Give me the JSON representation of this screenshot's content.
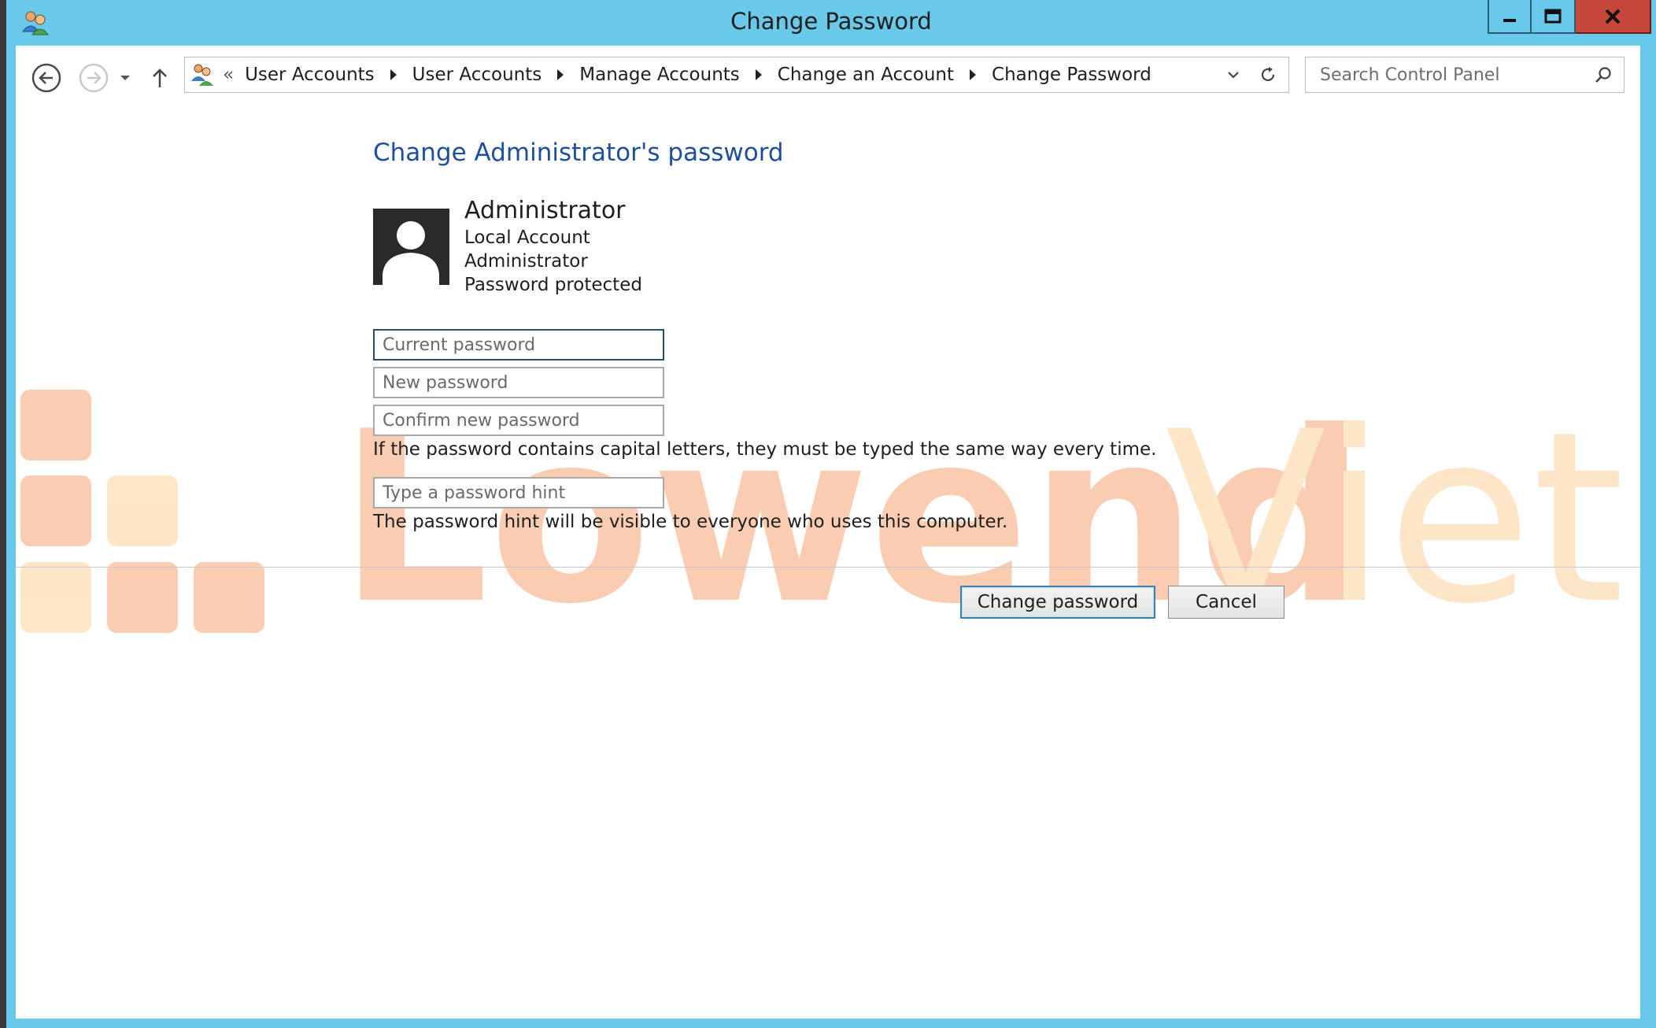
{
  "window": {
    "title": "Change Password"
  },
  "navigation": {
    "breadcrumb_prefix": "«",
    "breadcrumbs": [
      "User Accounts",
      "User Accounts",
      "Manage Accounts",
      "Change an Account",
      "Change Password"
    ]
  },
  "search": {
    "placeholder": "Search Control Panel",
    "value": ""
  },
  "page": {
    "heading": "Change Administrator's password",
    "account": {
      "name": "Administrator",
      "type": "Local Account",
      "role": "Administrator",
      "status": "Password protected"
    },
    "fields": {
      "current_placeholder": "Current password",
      "new_placeholder": "New password",
      "confirm_placeholder": "Confirm new password",
      "hint_placeholder": "Type a password hint"
    },
    "capital_note": "If the password contains capital letters, they must be typed the same way every time.",
    "hint_note": "The password hint will be visible to everyone who uses this computer.",
    "buttons": {
      "change": "Change password",
      "cancel": "Cancel"
    }
  },
  "watermark": {
    "text_main": "Lowend",
    "text_accent": "Viet"
  },
  "colors": {
    "titlebar": "#69c9ea",
    "close_button": "#c7463a",
    "heading": "#1e4e9e",
    "watermark_orange": "#f7b48f",
    "watermark_yellow": "#fbd9a5"
  },
  "icons": [
    "users-icon",
    "back-arrow-icon",
    "forward-arrow-icon",
    "history-dropdown-icon",
    "up-arrow-icon",
    "address-dropdown-icon",
    "refresh-icon",
    "search-icon",
    "minimize-icon",
    "maximize-icon",
    "close-icon",
    "user-avatar-icon"
  ]
}
